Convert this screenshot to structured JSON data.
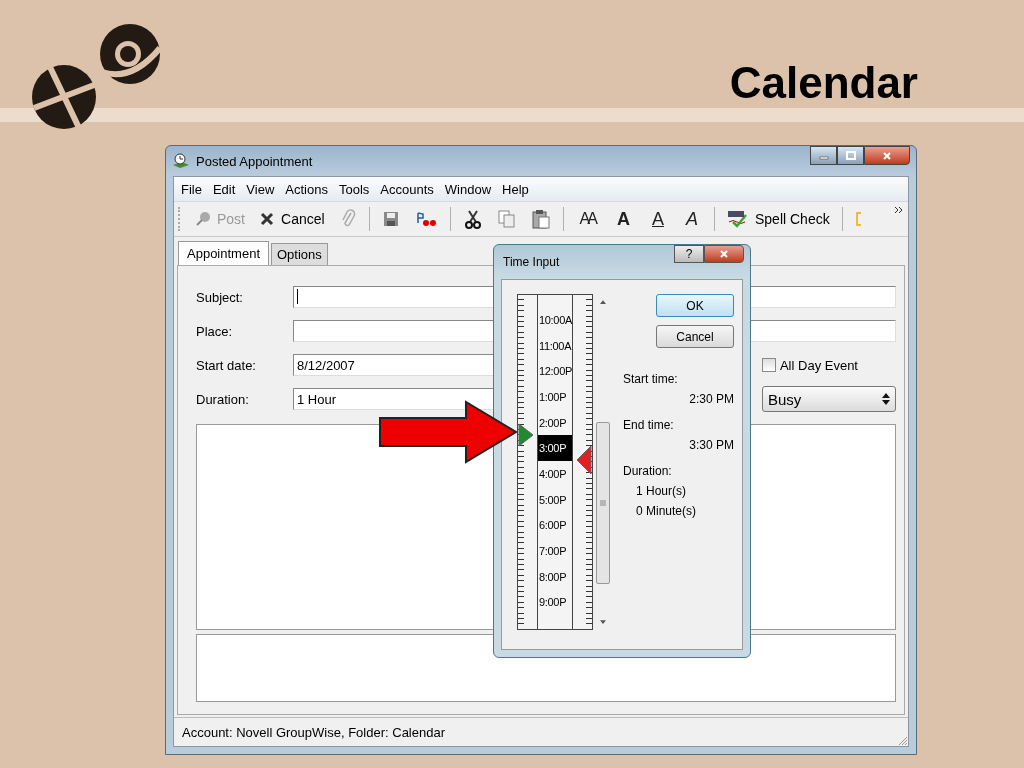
{
  "slide": {
    "title": "Calendar"
  },
  "window": {
    "title": "Posted Appointment"
  },
  "menu": [
    {
      "label": "File"
    },
    {
      "label": "Edit"
    },
    {
      "label": "View"
    },
    {
      "label": "Actions"
    },
    {
      "label": "Tools"
    },
    {
      "label": "Accounts"
    },
    {
      "label": "Window"
    },
    {
      "label": "Help"
    }
  ],
  "toolbar": {
    "post": {
      "label": "Post",
      "disabled": true
    },
    "cancel": {
      "label": "Cancel",
      "disabled": false
    },
    "attach_disabled": true,
    "format_buttons": [
      {
        "kind": "size",
        "label": "AA"
      },
      {
        "kind": "bold",
        "label": "A"
      },
      {
        "kind": "underline",
        "label": "A"
      },
      {
        "kind": "italic",
        "label": "A"
      }
    ],
    "spell_check": {
      "label": "Spell Check"
    }
  },
  "tabs": [
    {
      "label": "Appointment",
      "selected": true
    },
    {
      "label": "Options",
      "selected": false
    }
  ],
  "form": {
    "subject": {
      "label": "Subject:"
    },
    "place": {
      "label": "Place:"
    },
    "start_date": {
      "label": "Start date:",
      "value": "8/12/2007"
    },
    "duration": {
      "label": "Duration:",
      "value": "1 Hour"
    },
    "all_day_event": {
      "label": "All Day Event",
      "checked": false
    },
    "show_as": {
      "value": "Busy"
    }
  },
  "status_bar": "Account: Novell GroupWise,  Folder: Calendar",
  "dialog": {
    "title": "Time Input",
    "help": "?",
    "times": [
      {
        "label": "10:00A",
        "selected": false
      },
      {
        "label": "11:00A",
        "selected": false
      },
      {
        "label": "12:00P",
        "selected": false
      },
      {
        "label": "1:00P",
        "selected": false
      },
      {
        "label": "2:00P",
        "selected": false
      },
      {
        "label": "3:00P",
        "selected": true
      },
      {
        "label": "4:00P",
        "selected": false
      },
      {
        "label": "5:00P",
        "selected": false
      },
      {
        "label": "6:00P",
        "selected": false
      },
      {
        "label": "7:00P",
        "selected": false
      },
      {
        "label": "8:00P",
        "selected": false
      },
      {
        "label": "9:00P",
        "selected": false
      }
    ],
    "buttons": [
      {
        "label": "OK",
        "default": true
      },
      {
        "label": "Cancel",
        "default": false
      }
    ],
    "start_time": {
      "label": "Start time:",
      "value": "2:30 PM"
    },
    "end_time": {
      "label": "End time:",
      "value": "3:30 PM"
    },
    "duration": {
      "label": "Duration:",
      "lines": [
        "1 Hour(s)",
        "0 Minute(s)"
      ]
    }
  }
}
